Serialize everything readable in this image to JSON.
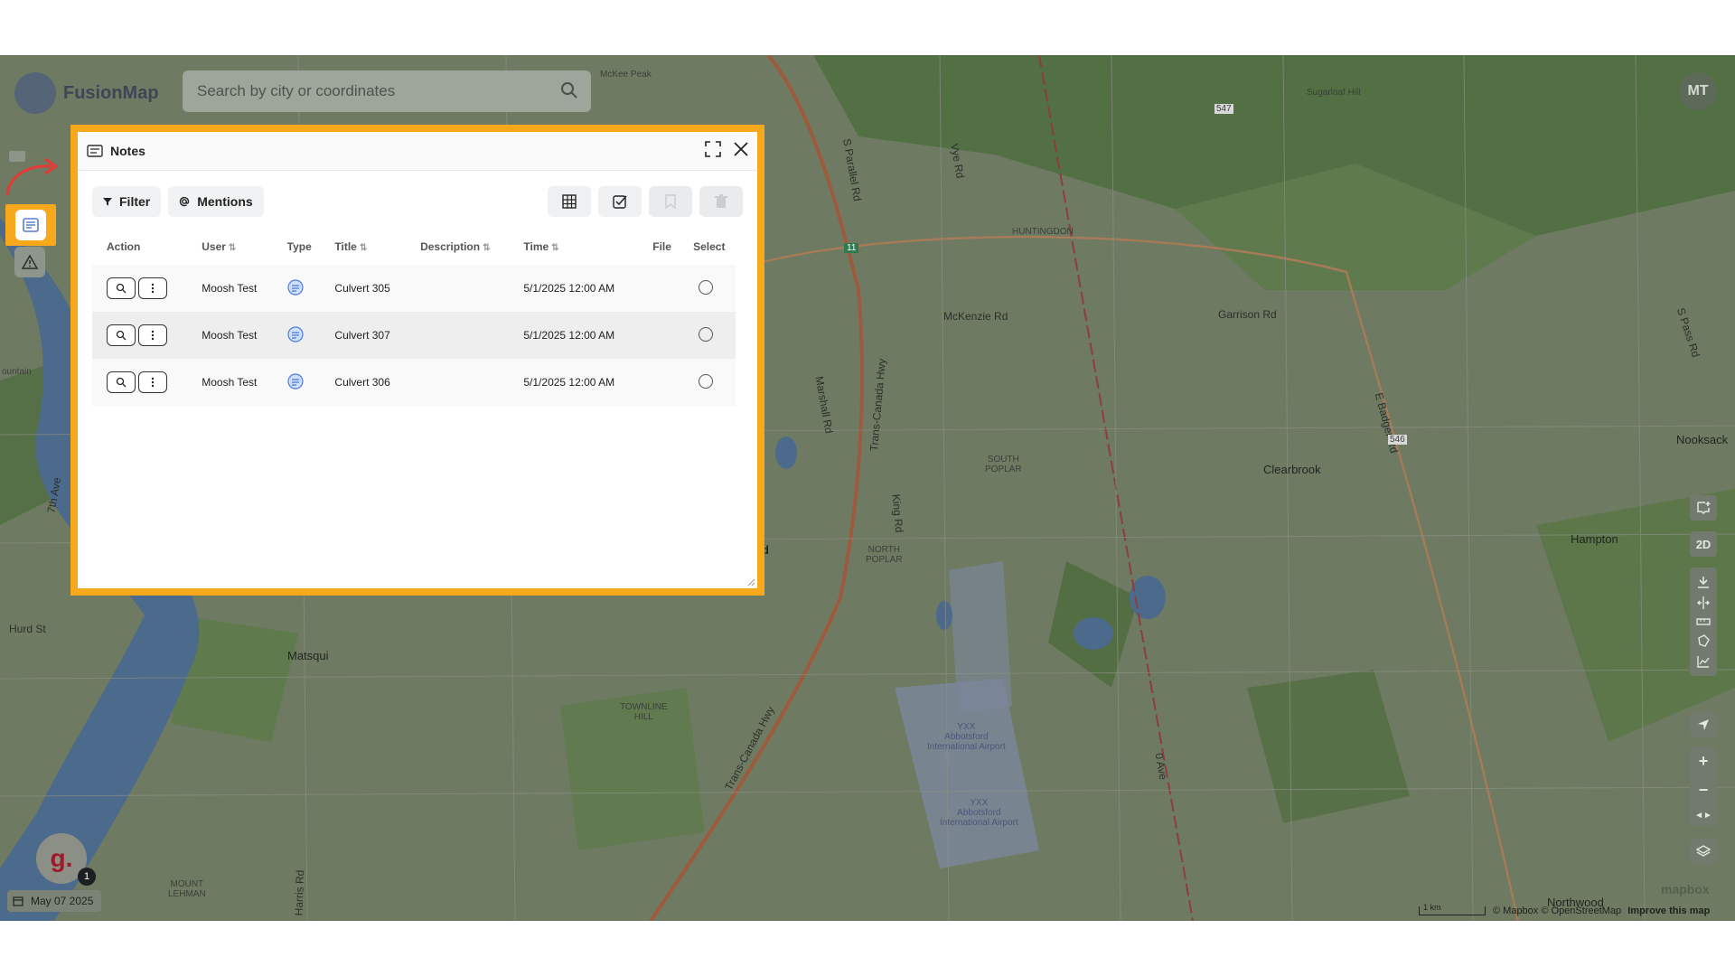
{
  "app": {
    "name": "FusionMap",
    "user_initials": "MT"
  },
  "search": {
    "placeholder": "Search by city or coordinates"
  },
  "notes_panel": {
    "title": "Notes",
    "filter_label": "Filter",
    "mentions_label": "Mentions",
    "columns": [
      "Action",
      "User",
      "Type",
      "Title",
      "Description",
      "Time",
      "File",
      "Select"
    ],
    "rows": [
      {
        "user": "Moosh Test",
        "type_icon": "note-icon",
        "title": "Culvert 305",
        "description": "",
        "time": "5/1/2025 12:00 AM",
        "file": ""
      },
      {
        "user": "Moosh Test",
        "type_icon": "note-icon",
        "title": "Culvert 307",
        "description": "",
        "time": "5/1/2025 12:00 AM",
        "file": ""
      },
      {
        "user": "Moosh Test",
        "type_icon": "note-icon",
        "title": "Culvert 306",
        "description": "",
        "time": "5/1/2025 12:00 AM",
        "file": ""
      }
    ]
  },
  "map": {
    "labels": {
      "mckee_peak": "McKee Peak",
      "sugarloaf_hill": "Sugarloaf Hill",
      "huntingdon": "HUNTINGDON",
      "mckenzie_rd": "McKenzie Rd",
      "garrison_rd": "Garrison Rd",
      "e_badger_rd": "E Badger Rd",
      "s_pass_rd": "S Pass Rd",
      "nooksack": "Nooksack",
      "clearbrook": "Clearbrook",
      "hampton": "Hampton",
      "south_poplar": "SOUTH\nPOPLAR",
      "north_poplar": "NORTH\nPOPLAR",
      "trans_canada_hwy": "Trans-Canada Hwy",
      "marshall_rd": "Marshall Rd",
      "king_rd": "King Rd",
      "matsqui": "Matsqui",
      "townline_hill": "TOWNLINE\nHILL",
      "yxx_1": "YXX\nAbbotsford\nInternational Airport",
      "yxx_2": "YXX\nAbbotsford\nInternational Airport",
      "mount_lehman": "MOUNT\nLEHMAN",
      "harris_rd": "Harris Rd",
      "hurd_st": "Hurd St",
      "seventh_ave": "7th Ave",
      "northwood": "Northwood",
      "vye_rd": "Vye Rd",
      "s_parallel_rd": "S Parallel Rd",
      "zero_ave": "0 Ave",
      "ord": "rd",
      "ountain": "ountain",
      "route_547": "547",
      "route_546": "546",
      "route_11": "11"
    },
    "date_label": "May 07 2025",
    "notification_count": "1",
    "scale_label": "1 km",
    "attribution": "© Mapbox © OpenStreetMap",
    "improve_link": "Improve this map",
    "mapbox_logo": "mapbox",
    "view_mode": "2D"
  }
}
